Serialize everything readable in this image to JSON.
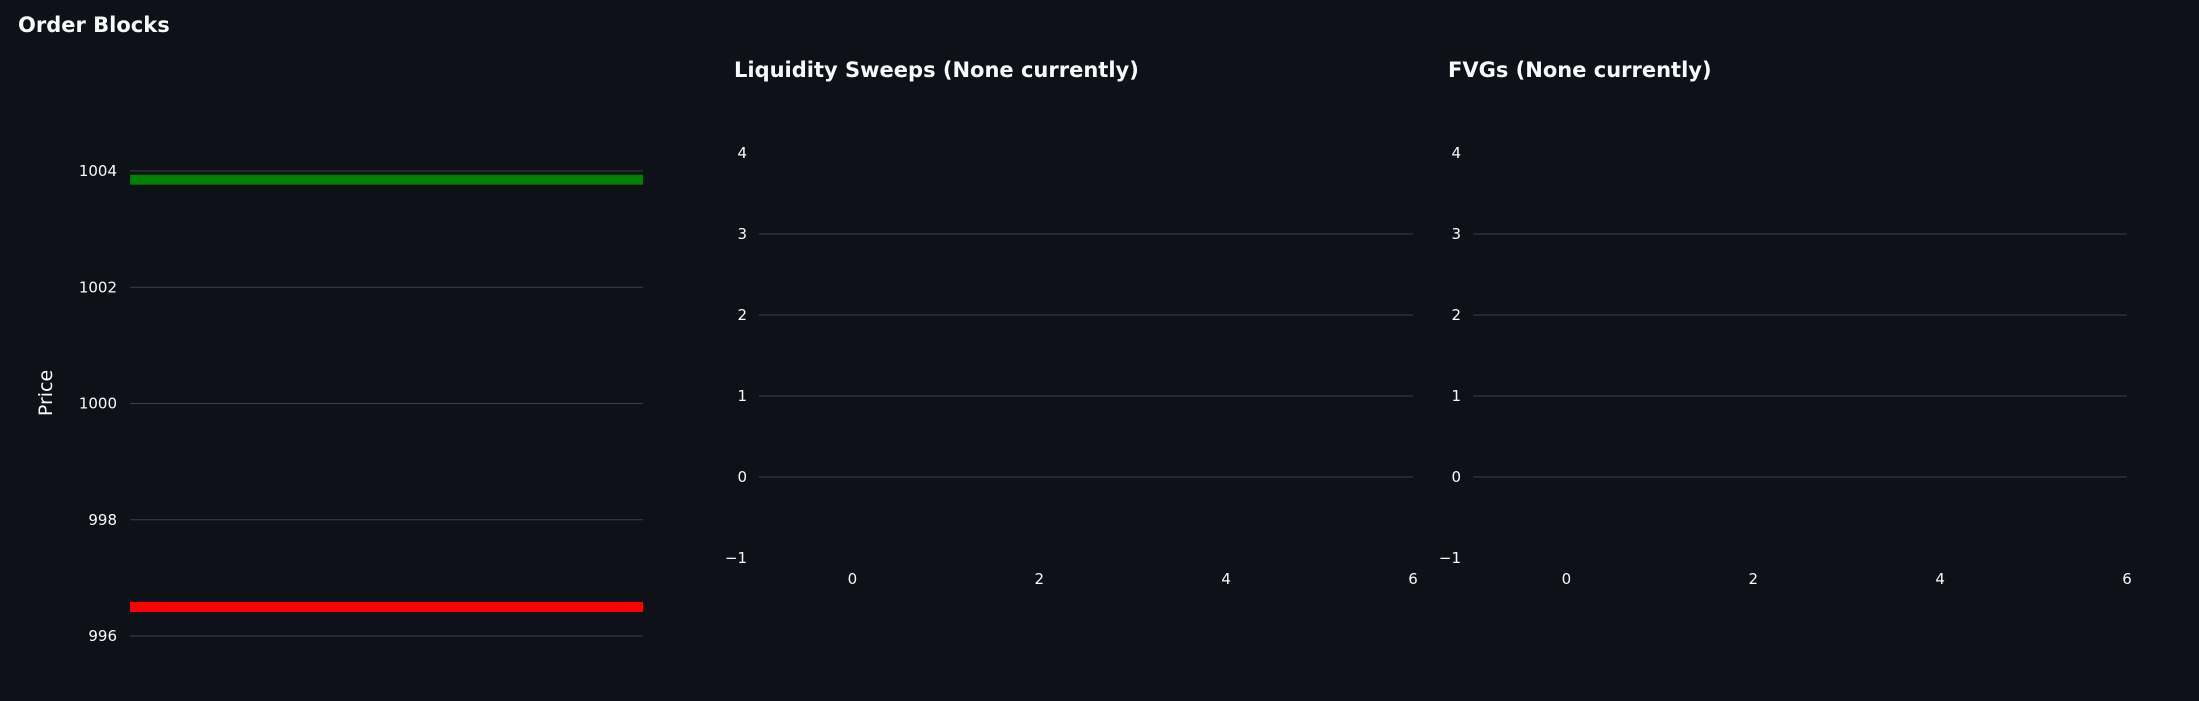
{
  "chart_data": [
    {
      "type": "bar",
      "title": "Order Blocks",
      "xlabel": "",
      "ylabel": "Price",
      "ylim": [
        995.8,
        1004.2
      ],
      "yticks": [
        996,
        998,
        1000,
        1002,
        1004
      ],
      "grid": true,
      "orientation": "horizontal",
      "levels": [
        {
          "value": 1003.85,
          "color": "#008000"
        },
        {
          "value": 996.5,
          "color": "#ff0000"
        }
      ]
    },
    {
      "type": "scatter",
      "title": "Liquidity Sweeps (None currently)",
      "xlabel": "",
      "ylabel": "",
      "xlim": [
        -1,
        6
      ],
      "ylim": [
        -1,
        4
      ],
      "xticks": [
        0,
        2,
        4,
        6
      ],
      "yticks": [
        -1,
        0,
        1,
        2,
        3,
        4
      ],
      "ytick_labels": [
        "−1",
        "0",
        "1",
        "2",
        "3",
        "4"
      ],
      "grid": true,
      "series": []
    },
    {
      "type": "scatter",
      "title": "FVGs (None currently)",
      "xlabel": "",
      "ylabel": "",
      "xlim": [
        -1,
        6
      ],
      "ylim": [
        -1,
        4
      ],
      "xticks": [
        0,
        2,
        4,
        6
      ],
      "yticks": [
        -1,
        0,
        1,
        2,
        3,
        4
      ],
      "ytick_labels": [
        "−1",
        "0",
        "1",
        "2",
        "3",
        "4"
      ],
      "grid": true,
      "series": []
    }
  ]
}
